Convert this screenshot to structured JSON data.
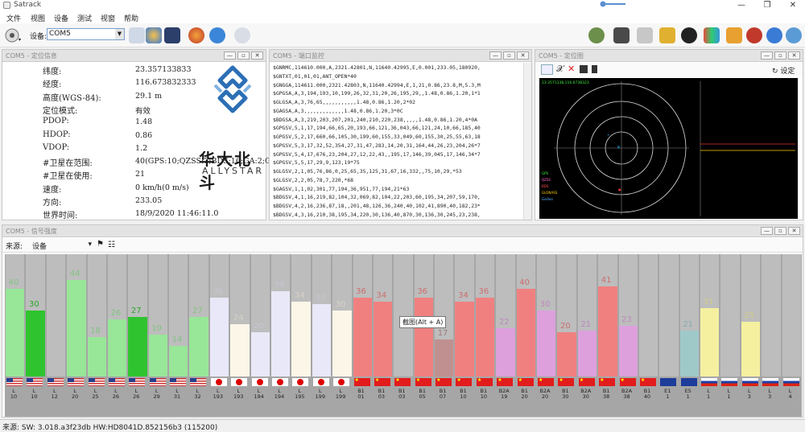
{
  "app": {
    "title": "Satrack"
  },
  "menu": [
    "文件",
    "视图",
    "设备",
    "测试",
    "视窗",
    "帮助"
  ],
  "toolbar": {
    "device_label": "设备:",
    "device_value": "COM5"
  },
  "info_panel": {
    "title": "COM5 - 定位信息",
    "rows": [
      {
        "label": "纬度:",
        "value": "23.357133833"
      },
      {
        "label": "经度:",
        "value": "116.673832333"
      },
      {
        "label": "高度(WGS-84):",
        "value": "29.1 m"
      },
      {
        "label": "定位模式:",
        "value": "有效"
      },
      {
        "label": "PDOP:",
        "value": "1.48"
      },
      {
        "label": "HDOP:",
        "value": "0.86"
      },
      {
        "label": "VDOP:",
        "value": "1.2"
      },
      {
        "label": "#卫星在范围:",
        "value": "40(GPS:10;QZSS:7;BDS:16;GA:2;GL:5"
      },
      {
        "label": "#卫星在使用:",
        "value": "21"
      },
      {
        "label": "速度:",
        "value": "0 km/h(0 m/s)"
      },
      {
        "label": "方向:",
        "value": "233.05"
      },
      {
        "label": "世界时间:",
        "value": "18/9/2020 11:46:11.0"
      }
    ],
    "logo_text": "华大北斗",
    "logo_sub": "ALLYSTAR"
  },
  "nmea_panel": {
    "title": "COM5 - 端口监控",
    "lines": [
      "$GNRMC,114610.000,A,2321.42801,N,11640.42995,E,0.001,233.05,180920,",
      "$GNTXT,01,01,01,ANT_OPEN*40",
      "$GNGGA,114611.000,2321.42803,N,11640.42994,E,1,21,0.86,23.8,M,5.3,M",
      "$GPGSA,A,3,194,193,10,199,26,32,31,20,26,195,29,,1.48,0.86,1.20,1*1",
      "$GLGSA,A,3,76,65,,,,,,,,,,,1.48,0.86,1.20,2*02",
      "$GAGSA,A,3,,,,,,,,,,,,,1.48,0.86,1.20,3*0C",
      "$BDGSA,A,3,219,203,207,201,240,210,220,238,,,,,1.48,0.86,1.20,4*0A",
      "$GPGSV,5,1,17,194,66,65,20,193,66,121,36,043,66,121,24,10,66,185,40",
      "$GPGSV,5,2,17,660,66,105,30,199,60,155,33,049,60,155,30,25,55,63,18",
      "$GPGSV,5,3,17,32,52,354,27,31,47,283,14,20,31,164,44,26,23,204,26*7",
      "$GPGSV,5,4,17,676,23,204,27,12,22,43,,195,17,146,39,045,17,146,34*7",
      "$GPGSV,5,5,17,29,9,123,19*75",
      "$GLGSV,2,1,05,76,86,0,25,65,35,125,31,67,16,332,,75,10,29,*53",
      "$GLGSV,2,2,05,78,7,220,*68",
      "$GAGSV,1,1,02,301,77,194,36,951,77,194,21*63",
      "$BDGSV,4,1,16,219,82,104,32,069,82,104,22,203,60,195,34,207,59,170,",
      "$BDGSV,4,2,16,236,87,18,,201,48,126,36,240,40,102,41,890,40,182,23*",
      "$BDGSV,4,3,16,210,38,195,34,220,30,136,40,870,30,136,30,245,23,238,",
      "$BDGSV,4,4,16,205,21,257,,238,18,197,20,888,18,197,21,208,13,193,17",
      "$GNRMC,114611.000,A,2321.42803,N,11640.42994,E,0.001,233.05,180920,",
      "$GNTXT,01,01,01,ANT_OPEN*40"
    ]
  },
  "pos_panel": {
    "title": "COM5 - 定位图",
    "settings": "设定",
    "coord_text": "23.3571338,116.6738323",
    "legend": [
      "GPS",
      "QZSS",
      "BDS",
      "GLONASS",
      "Galileo"
    ]
  },
  "signal_panel": {
    "title": "COM5 - 信号强度",
    "source_label": "来源:",
    "source_value": "设备",
    "sats": [
      {
        "sys": "L",
        "prn": "10",
        "cn0": 40,
        "flag": "us",
        "color": "#98e698"
      },
      {
        "sys": "L",
        "prn": "10",
        "cn0": 30,
        "flag": "us",
        "color": "#2fc42f"
      },
      {
        "sys": "L",
        "prn": "12",
        "cn0": null,
        "flag": "us",
        "color": "#98e698"
      },
      {
        "sys": "L",
        "prn": "20",
        "cn0": 44,
        "flag": "us",
        "color": "#98e698"
      },
      {
        "sys": "L",
        "prn": "25",
        "cn0": 18,
        "flag": "us",
        "color": "#98e698"
      },
      {
        "sys": "L",
        "prn": "26",
        "cn0": 26,
        "flag": "us",
        "color": "#98e698"
      },
      {
        "sys": "L",
        "prn": "26",
        "cn0": 27,
        "flag": "us",
        "color": "#2fc42f"
      },
      {
        "sys": "L",
        "prn": "29",
        "cn0": 19,
        "flag": "us",
        "color": "#98e698"
      },
      {
        "sys": "L",
        "prn": "31",
        "cn0": 14,
        "flag": "us",
        "color": "#98e698"
      },
      {
        "sys": "L",
        "prn": "32",
        "cn0": 27,
        "flag": "us",
        "color": "#98e698"
      },
      {
        "sys": "L",
        "prn": "193",
        "cn0": 36,
        "flag": "jp",
        "color": "#e8e8f8"
      },
      {
        "sys": "L",
        "prn": "193",
        "cn0": 24,
        "flag": "jp",
        "color": "#fbf6e8"
      },
      {
        "sys": "L",
        "prn": "194",
        "cn0": 20,
        "flag": "jp",
        "color": "#e8e8f8"
      },
      {
        "sys": "L",
        "prn": "194",
        "cn0": 39,
        "flag": "jp",
        "color": "#e8e8f8"
      },
      {
        "sys": "L",
        "prn": "195",
        "cn0": 34,
        "flag": "jp",
        "color": "#fbf6e8"
      },
      {
        "sys": "L",
        "prn": "199",
        "cn0": 33,
        "flag": "jp",
        "color": "#e8e8f8"
      },
      {
        "sys": "L",
        "prn": "199",
        "cn0": 30,
        "flag": "jp",
        "color": "#fbf6e8"
      },
      {
        "sys": "B1",
        "prn": "01",
        "cn0": 36,
        "flag": "cn",
        "color": "#f08080"
      },
      {
        "sys": "B1",
        "prn": "03",
        "cn0": 34,
        "flag": "cn",
        "color": "#f08080"
      },
      {
        "sys": "B1",
        "prn": "03",
        "cn0": null,
        "flag": "cn",
        "color": "#f08080"
      },
      {
        "sys": "B1",
        "prn": "05",
        "cn0": 36,
        "flag": "cn",
        "color": "#f08080"
      },
      {
        "sys": "B1",
        "prn": "07",
        "cn0": 17,
        "flag": "cn",
        "color": "#c09090"
      },
      {
        "sys": "B1",
        "prn": "10",
        "cn0": 34,
        "flag": "cn",
        "color": "#f08080"
      },
      {
        "sys": "B1",
        "prn": "10",
        "cn0": 36,
        "flag": "cn",
        "color": "#f08080"
      },
      {
        "sys": "B2A",
        "prn": "19",
        "cn0": 22,
        "flag": "cn",
        "color": "#dda0dd"
      },
      {
        "sys": "B1",
        "prn": "20",
        "cn0": 40,
        "flag": "cn",
        "color": "#f08080"
      },
      {
        "sys": "B2A",
        "prn": "20",
        "cn0": 30,
        "flag": "cn",
        "color": "#dda0dd"
      },
      {
        "sys": "B1",
        "prn": "30",
        "cn0": 20,
        "flag": "cn",
        "color": "#f08080"
      },
      {
        "sys": "B2A",
        "prn": "30",
        "cn0": 21,
        "flag": "cn",
        "color": "#dda0dd"
      },
      {
        "sys": "B1",
        "prn": "38",
        "cn0": 41,
        "flag": "cn",
        "color": "#f08080"
      },
      {
        "sys": "B2A",
        "prn": "38",
        "cn0": 23,
        "flag": "cn",
        "color": "#dda0dd"
      },
      {
        "sys": "B1",
        "prn": "40",
        "cn0": null,
        "flag": "cn",
        "color": "#f08080"
      },
      {
        "sys": "E1",
        "prn": "1",
        "cn0": null,
        "flag": "eu",
        "color": "#b0b8e8"
      },
      {
        "sys": "E5",
        "prn": "1",
        "cn0": 21,
        "flag": "eu",
        "color": "#9fc9c9"
      },
      {
        "sys": "L",
        "prn": "1",
        "cn0": 31,
        "flag": "ru",
        "color": "#f5f0a0"
      },
      {
        "sys": "L",
        "prn": "1",
        "cn0": null,
        "flag": "ru",
        "color": "#f5f0a0"
      },
      {
        "sys": "L",
        "prn": "3",
        "cn0": 25,
        "flag": "ru",
        "color": "#f5f0a0"
      },
      {
        "sys": "L",
        "prn": "3",
        "cn0": null,
        "flag": "ru",
        "color": "#f5f0a0"
      },
      {
        "sys": "L",
        "prn": "4",
        "cn0": null,
        "flag": "ru",
        "color": "#f5f0a0"
      }
    ],
    "tooltip": "截图(Alt + A)"
  },
  "status": {
    "text": "来源: SW: 3.018.a3f23db   HW:HD8041D.852156b3   (115200)"
  }
}
